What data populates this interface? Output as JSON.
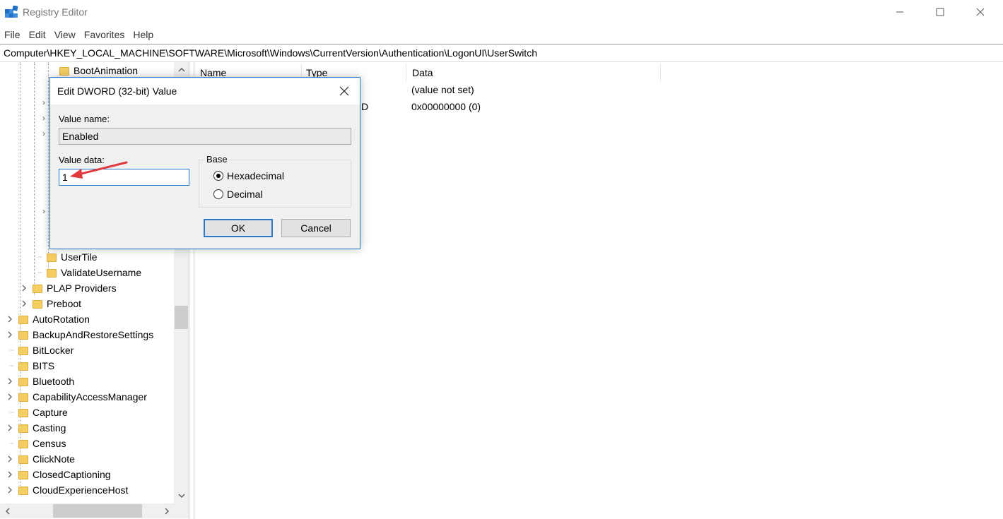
{
  "window": {
    "title": "Registry Editor"
  },
  "menu": [
    "File",
    "Edit",
    "View",
    "Favorites",
    "Help"
  ],
  "address": "Computer\\HKEY_LOCAL_MACHINE\\SOFTWARE\\Microsoft\\Windows\\CurrentVersion\\Authentication\\LogonUI\\UserSwitch",
  "tree": {
    "top_items": [
      "BootAnimation"
    ],
    "items": [
      {
        "label": "UserTile",
        "expandable": false
      },
      {
        "label": "ValidateUsername",
        "expandable": false
      },
      {
        "label": "PLAP Providers",
        "expandable": true
      },
      {
        "label": "Preboot",
        "expandable": true
      },
      {
        "label": "AutoRotation",
        "expandable": true
      },
      {
        "label": "BackupAndRestoreSettings",
        "expandable": true
      },
      {
        "label": "BitLocker",
        "expandable": false
      },
      {
        "label": "BITS",
        "expandable": false
      },
      {
        "label": "Bluetooth",
        "expandable": true
      },
      {
        "label": "CapabilityAccessManager",
        "expandable": true
      },
      {
        "label": "Capture",
        "expandable": false
      },
      {
        "label": "Casting",
        "expandable": true
      },
      {
        "label": "Census",
        "expandable": false
      },
      {
        "label": "ClickNote",
        "expandable": true
      },
      {
        "label": "ClosedCaptioning",
        "expandable": true
      },
      {
        "label": "CloudExperienceHost",
        "expandable": true
      }
    ]
  },
  "values": {
    "columns": [
      "Name",
      "Type",
      "Data"
    ],
    "rows": [
      {
        "type_partial": "",
        "data": "(value not set)"
      },
      {
        "type_partial": "D",
        "data": "0x00000000 (0)"
      }
    ]
  },
  "dialog": {
    "title": "Edit DWORD (32-bit) Value",
    "value_name_label": "Value name:",
    "value_name": "Enabled",
    "value_data_label": "Value data:",
    "value_data": "1",
    "base_label": "Base",
    "radio_hex": "Hexadecimal",
    "radio_dec": "Decimal",
    "ok": "OK",
    "cancel": "Cancel"
  },
  "colors": {
    "accent": "#2a78c9",
    "folder": "#f4cd63",
    "annotation_arrow": "#e0393e"
  }
}
